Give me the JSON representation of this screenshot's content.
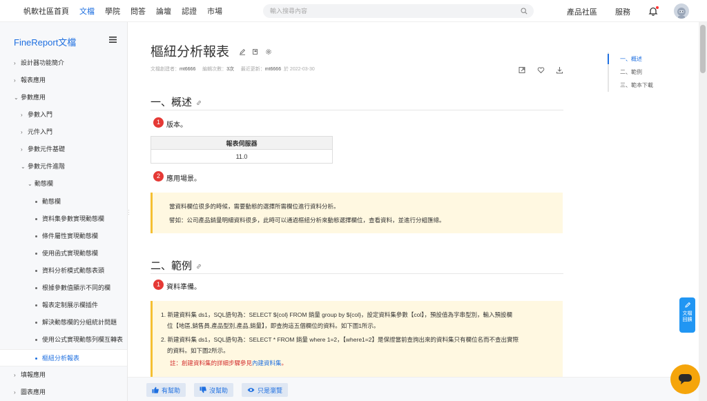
{
  "topnav": {
    "items": [
      "帆軟社區首頁",
      "文檔",
      "學院",
      "問答",
      "論壇",
      "認證",
      "市場"
    ],
    "search_placeholder": "輸入搜尋內容",
    "right_items": [
      "產品社區",
      "服務"
    ]
  },
  "sidebar": {
    "title": "FineReport文檔",
    "items": [
      {
        "label": "設計器功能簡介"
      },
      {
        "label": "報表應用"
      },
      {
        "label": "參數應用"
      },
      {
        "label": "參數入門"
      },
      {
        "label": "元件入門"
      },
      {
        "label": "參數元件基礎"
      },
      {
        "label": "參數元件進階"
      },
      {
        "label": "動態欄"
      },
      {
        "label": "動態欄"
      },
      {
        "label": "資料集參數實現動態欄"
      },
      {
        "label": "條件屬性實現動態欄"
      },
      {
        "label": "使用函式實現動態欄"
      },
      {
        "label": "資料分析模式動態表頭"
      },
      {
        "label": "根據參數值顯示不同的欄"
      },
      {
        "label": "報表定制展示欄插件"
      },
      {
        "label": "解決動態欄的分組統計問題"
      },
      {
        "label": "使用公式實現動態列欄互轉表"
      },
      {
        "label": "樞紐分析報表"
      },
      {
        "label": "填報應用"
      },
      {
        "label": "圖表應用"
      }
    ]
  },
  "doc": {
    "title": "樞紐分析報表",
    "meta": {
      "creator_label": "文檔創建者：",
      "creator": "mt6666",
      "edits_label": "編輯次數：",
      "edits": "3次",
      "updated_label": "最近更新：",
      "updater": "mt6666",
      "updated_on": "於 2022-03-30"
    },
    "section1": {
      "heading": "一、概述",
      "step1_num": "1",
      "step1_text": "版本。",
      "table_header": "報表伺服器",
      "table_value": "11.0",
      "step2_num": "2",
      "step2_text": "應用場景。",
      "note_line1": "當資料欄位很多的時候，需要動態的選擇所需欄位進行資料分析。",
      "note_line2": "譬如：公司產品銷量明細資料很多，此時可以通過樞紐分析來動態選擇欄位，查看資料，並進行分組匯總。"
    },
    "section2": {
      "heading": "二、範例",
      "step1_num": "1",
      "step1_text": "資料準備。",
      "item1_line1": "1. 新建資料集 ds1，SQL語句為：SELECT ${col} FROM 銷量 group by ${col}，設定資料集參數【col】，預設值為字串型別，輸入預設欄",
      "item1_line2": "位【地區,銷售員,產品型別,產品,銷量】，即查詢這五個欄位的資料。如下圖1所示。",
      "item2_line1": "2. 新建資料集 ds1，SQL語句為：SELECT * FROM 銷量 where 1=2，【where1=2】是保證當前查詢出來的資料集只有欄位名而不查出實際",
      "item2_line2": "的資料。如下圖2所示。",
      "note_prefix": "註：創建資料集的詳細步驟參見",
      "note_link": "內建資料集",
      "note_suffix": "。"
    }
  },
  "toc": [
    "一、概述",
    "二、範例",
    "三、範本下載"
  ],
  "feedback": {
    "helpful": "有幫助",
    "not_helpful": "沒幫助",
    "just_browsing": "只是瀏覽"
  },
  "float_button": {
    "line1": "文檔",
    "line2": "回饋"
  },
  "colors": {
    "accent": "#1e6fe0",
    "step_badge": "#e53935",
    "note_bg": "#fff8e1",
    "note_border": "#f5c033",
    "chat_button": "#f5a50b"
  }
}
